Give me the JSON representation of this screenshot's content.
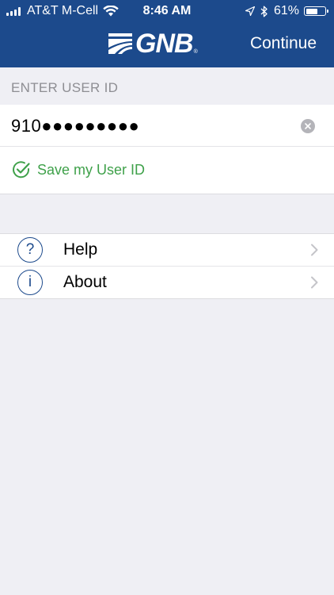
{
  "status_bar": {
    "carrier": "AT&T M-Cell",
    "time": "8:46 AM",
    "battery_percent": "61%",
    "battery_level": 0.61
  },
  "nav": {
    "logo_text": "GNB",
    "logo_mark": "®",
    "continue_label": "Continue"
  },
  "login": {
    "section_header": "ENTER USER ID",
    "user_id_value": "910●●●●●●●●●",
    "save_label": "Save my User ID"
  },
  "menu": {
    "items": [
      {
        "label": "Help",
        "icon_glyph": "?",
        "icon": "help-circle-icon"
      },
      {
        "label": "About",
        "icon_glyph": "i",
        "icon": "info-circle-icon"
      }
    ]
  },
  "colors": {
    "nav_bg": "#1c4a8c",
    "accent_green": "#3fa14a",
    "page_bg": "#efeff4"
  }
}
